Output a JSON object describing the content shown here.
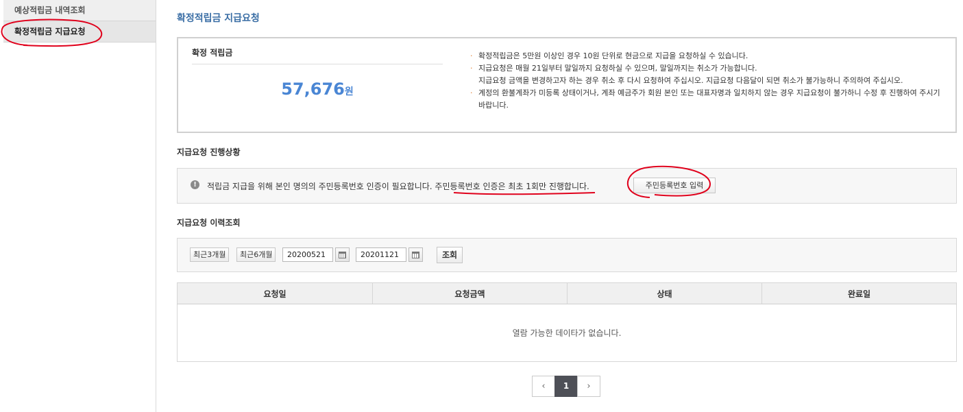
{
  "sidebar": {
    "items": [
      {
        "label": "예상적립금 내역조회"
      },
      {
        "label": "확정적립금 지급요청"
      }
    ]
  },
  "main": {
    "title": "확정적립금 지급요청",
    "summary": {
      "label": "확정 적립금",
      "amount": "57,676",
      "unit": "원",
      "notes": [
        "확정적립금은 5만원 이상인 경우 10원 단위로 현금으로 지급을 요청하실 수 있습니다.",
        "지급요청은 매월 21일부터 말일까지 요청하실 수 있으며, 말일까지는 취소가 가능합니다.\n지급요청 금액을 변경하고자 하는 경우 취소 후 다시 요청하여 주십시오. 지급요청 다음달이 되면 취소가 불가능하니 주의하여 주십시오.",
        "계정의 환불계좌가 미등록 상태이거나, 계좌 예금주가 회원 본인 또는 대표자명과 일치하지 않는 경우 지급요청이 불가하니 수정 후 진행하여 주시기 바랍니다."
      ]
    },
    "progress": {
      "title": "지급요청 진행상황",
      "notice_part1": "적립금 지급을 위해 본인 명의의 주민등록번호 인증이 필요합니다. ",
      "notice_part2": "주민등록번호 인증은 최초 1회만 진행합니다.",
      "button": "주민등록번호 입력"
    },
    "history": {
      "title": "지급요청 이력조회",
      "period_buttons": [
        "최근3개월",
        "최근6개월"
      ],
      "start_date": "20200521",
      "end_date": "20201121",
      "search_button": "조회",
      "columns": [
        "요청일",
        "요청금액",
        "상태",
        "완료일"
      ],
      "empty_message": "열람 가능한 데이타가 없습니다."
    },
    "pagination": {
      "prev": "‹",
      "current": "1",
      "next": "›"
    }
  },
  "colors": {
    "title": "#3a6ea5",
    "amount": "#4a86d4",
    "bullet": "#e07b2a",
    "annotation": "#e0001b"
  },
  "icons": [
    "info-icon",
    "calendar-icon",
    "chevron-left-icon",
    "chevron-right-icon"
  ]
}
